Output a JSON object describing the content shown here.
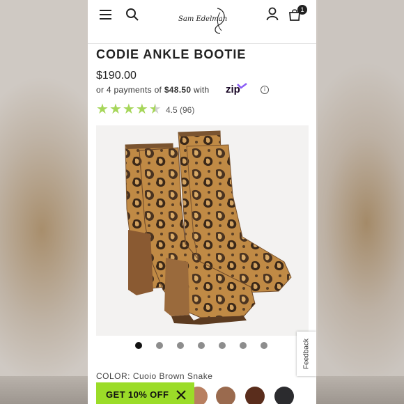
{
  "header": {
    "logo_text": "Sam Edelman",
    "cart_count": "1",
    "icons": [
      "menu-icon",
      "search-icon",
      "user-icon",
      "bag-icon"
    ]
  },
  "product": {
    "title": "CODIE ANKLE BOOTIE",
    "price": "$190.00",
    "payment_prefix": "or 4 payments of ",
    "payment_amount": "$48.50",
    "payment_suffix": " with",
    "payment_brand": "zip",
    "rating_value": 4.5,
    "rating_text": "4.5 (96)",
    "color_label": "COLOR: Cuoio Brown Snake"
  },
  "gallery": {
    "image_count": 7,
    "active_index": 0
  },
  "swatches": [
    "#b87f60",
    "#9a6a4e",
    "#5a2d1c",
    "#2b2b2e"
  ],
  "feedback_label": "Feedback",
  "promo": {
    "label": "GET 10% OFF"
  },
  "colors": {
    "accent_green": "#9bdc28",
    "star_green": "#a6d65a",
    "zip_purple": "#8a5cf6"
  }
}
